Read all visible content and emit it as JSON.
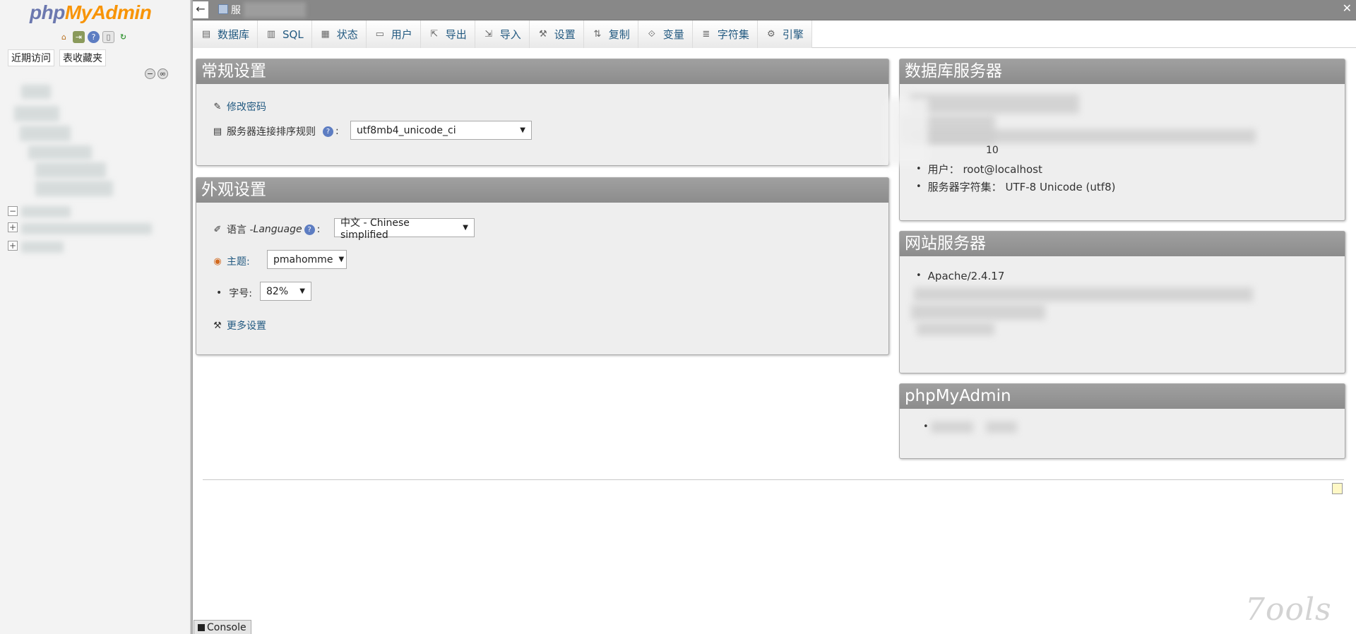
{
  "sidebar": {
    "logo_php": "php",
    "logo_myadmin": "MyAdmin",
    "icons": [
      "home-icon",
      "exit-icon",
      "help-icon",
      "docs-icon",
      "reload-icon"
    ],
    "tabs": {
      "recent": "近期访问",
      "favorites": "表收藏夹"
    }
  },
  "topbar": {
    "back": "←",
    "breadcrumb": "服",
    "close": "✕"
  },
  "menu": [
    {
      "label": "数据库",
      "icon": "database-icon"
    },
    {
      "label": "SQL",
      "icon": "sql-icon"
    },
    {
      "label": "状态",
      "icon": "status-icon"
    },
    {
      "label": "用户",
      "icon": "users-icon"
    },
    {
      "label": "导出",
      "icon": "export-icon"
    },
    {
      "label": "导入",
      "icon": "import-icon"
    },
    {
      "label": "设置",
      "icon": "settings-wrench-icon"
    },
    {
      "label": "复制",
      "icon": "replication-icon"
    },
    {
      "label": "变量",
      "icon": "variables-icon"
    },
    {
      "label": "字符集",
      "icon": "charset-icon"
    },
    {
      "label": "引擎",
      "icon": "engines-icon"
    }
  ],
  "general_settings": {
    "title": "常规设置",
    "change_password": "修改密码",
    "collation_label": "服务器连接排序规则",
    "collation_value": "utf8mb4_unicode_ci"
  },
  "appearance_settings": {
    "title": "外观设置",
    "language_label": "语言 - ",
    "language_label_en": "Language",
    "language_value": "中文 - Chinese simplified",
    "theme_label": "主题:",
    "theme_value": "pmahomme",
    "fontsize_label": "字号:",
    "fontsize_value": "82%",
    "more_settings": "更多设置"
  },
  "db_server": {
    "title": "数据库服务器",
    "partial_value": "10",
    "user_label": "用户：",
    "user_value": "root@localhost",
    "charset_label": "服务器字符集：",
    "charset_value": "UTF-8 Unicode (utf8)"
  },
  "web_server": {
    "title": "网站服务器",
    "apache": "Apache/2.4.17"
  },
  "pma": {
    "title": "phpMyAdmin"
  },
  "console": {
    "label": "Console"
  },
  "watermark": "7ools",
  "colors": {
    "panel_header": "#999999",
    "link": "#235a81",
    "logo_php": "#6c78af",
    "logo_myadmin": "#f89406"
  }
}
